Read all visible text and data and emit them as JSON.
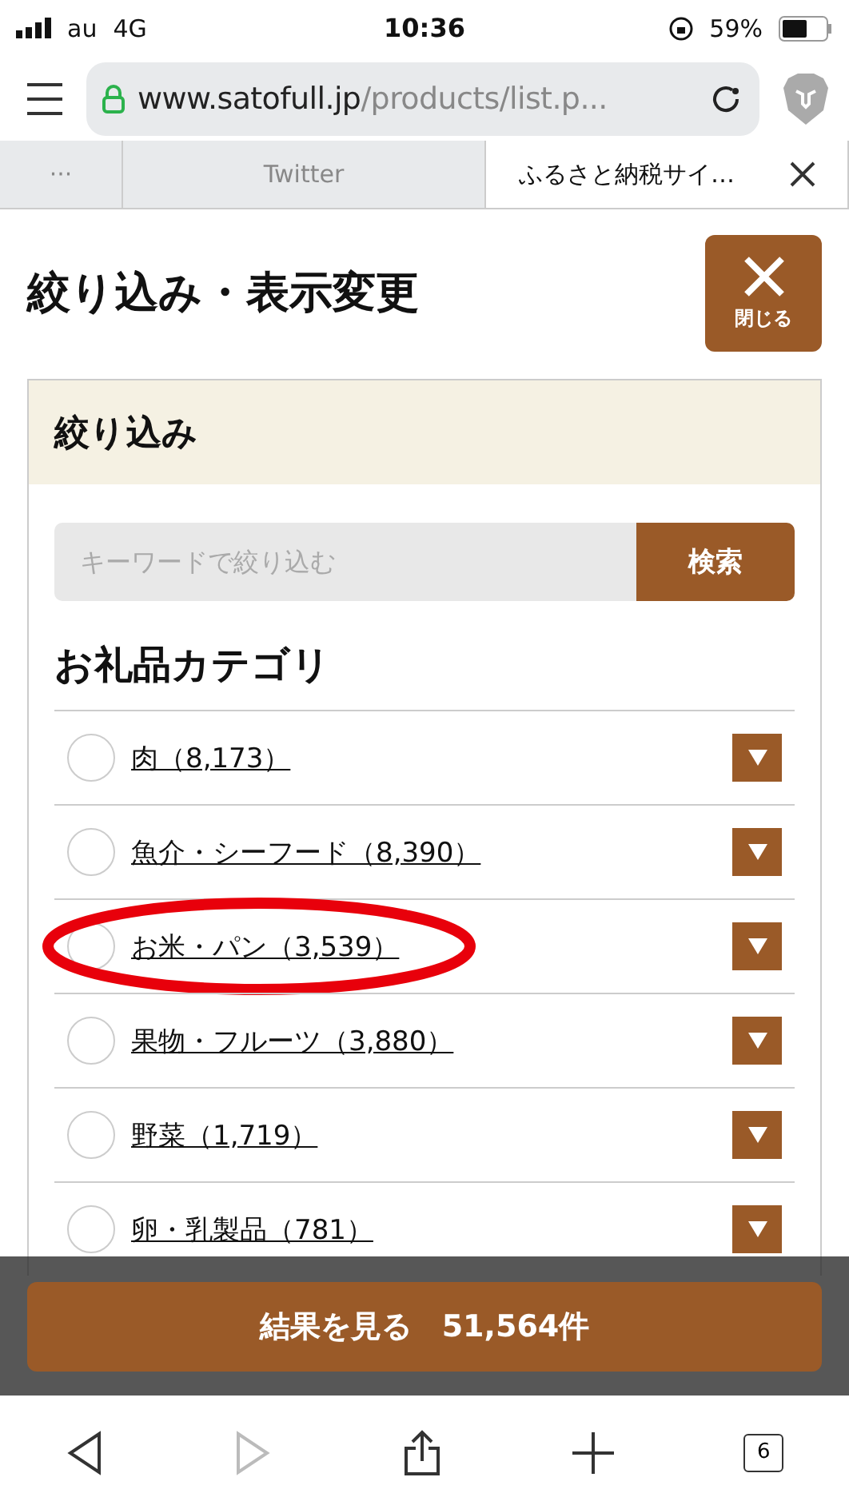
{
  "status_bar": {
    "carrier": "au",
    "network": "4G",
    "time": "10:36",
    "battery": "59%"
  },
  "browser": {
    "url_host": "www.satofull.jp",
    "url_path": "/products/list.p...",
    "tabs": [
      {
        "label": "···",
        "selected": false
      },
      {
        "label": "Twitter",
        "selected": false
      },
      {
        "label": "ふるさと納税サイ…",
        "selected": true
      }
    ]
  },
  "page": {
    "title": "絞り込み・表示変更",
    "close_label": "閉じる",
    "panel_title": "絞り込み",
    "search": {
      "placeholder": "キーワードで絞り込む",
      "button": "検索"
    },
    "category_heading": "お礼品カテゴリ",
    "categories": [
      {
        "label": "肉（8,173）",
        "selected": false,
        "circled": false
      },
      {
        "label": "魚介・シーフード（8,390）",
        "selected": false,
        "circled": false
      },
      {
        "label": "お米・パン（3,539）",
        "selected": false,
        "circled": true
      },
      {
        "label": "果物・フルーツ（3,880）",
        "selected": false,
        "circled": false
      },
      {
        "label": "野菜（1,719）",
        "selected": false,
        "circled": false
      },
      {
        "label": "卵・乳製品（781）",
        "selected": false,
        "circled": false
      }
    ],
    "results_button": "結果を見る　51,564件"
  },
  "toolbar": {
    "back_disabled": false,
    "forward_disabled": true,
    "tab_count": "6"
  }
}
